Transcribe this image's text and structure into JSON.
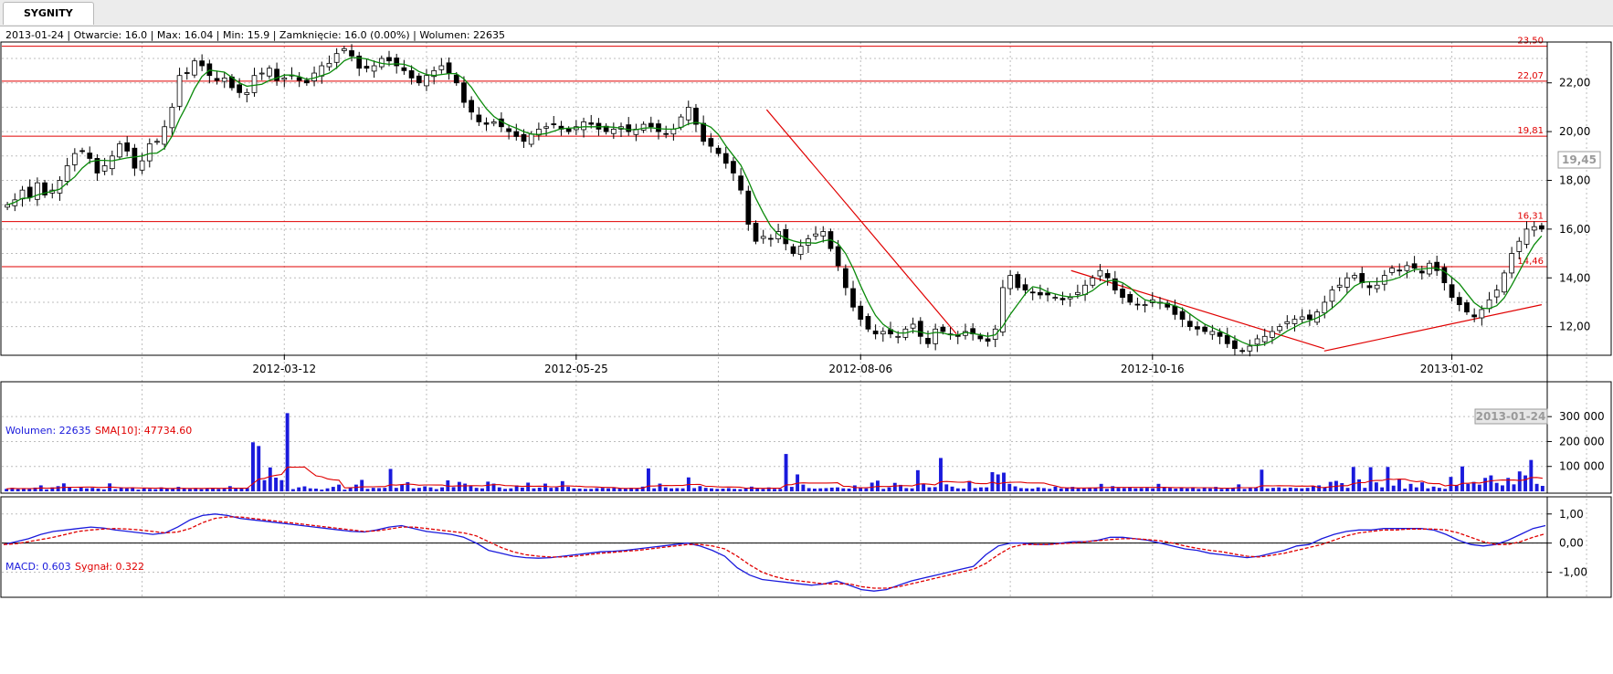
{
  "tab": {
    "label": "SYGNITY"
  },
  "info_line": "2013-01-24 | Otwarcie: 16.0 | Max: 16.04 | Min: 15.9 | Zamknięcie: 16.0 (0.00%)  | Wolumen: 22635",
  "cursor": {
    "price_label": "19,45",
    "date_label": "2013-01-24"
  },
  "volume_legend": {
    "volume": "Wolumen: 22635",
    "sma": "SMA[10]: 47734.60"
  },
  "macd_legend": {
    "macd": "MACD: 0.603",
    "signal": "Sygnał: 0.322"
  },
  "colors": {
    "up": "#ffffff",
    "down": "#000000",
    "sma": "#0a8a0a",
    "level": "#e00000",
    "volume": "#1a1adc",
    "vol_sma": "#e00000",
    "macd": "#1a1adc",
    "signal": "#e00000"
  },
  "chart_data": [
    {
      "type": "candlestick",
      "x_ticks": [
        "2012-03-12",
        "2012-05-25",
        "2012-08-06",
        "2012-10-16",
        "2013-01-02"
      ],
      "y_ticks": [
        "12,00",
        "14,00",
        "16,00",
        "18,00",
        "20,00",
        "22,00"
      ],
      "ylim": [
        10.9,
        23.6
      ],
      "horizontal_levels": [
        {
          "value": 23.5,
          "label": "23,50"
        },
        {
          "value": 22.07,
          "label": "22,07"
        },
        {
          "value": 19.81,
          "label": "19,81"
        },
        {
          "value": 16.31,
          "label": "16,31"
        },
        {
          "value": 14.46,
          "label": "14,46"
        }
      ],
      "closes": [
        17.0,
        17.2,
        17.6,
        17.3,
        17.9,
        17.4,
        17.6,
        18.0,
        18.6,
        19.1,
        19.2,
        18.9,
        18.3,
        18.6,
        19.0,
        19.5,
        19.2,
        18.5,
        18.8,
        19.5,
        19.6,
        20.2,
        21.0,
        22.3,
        22.4,
        22.9,
        22.7,
        22.3,
        22.1,
        22.2,
        21.8,
        21.6,
        21.6,
        22.3,
        22.4,
        22.6,
        22.1,
        22.2,
        22.3,
        22.1,
        22.0,
        22.4,
        22.7,
        22.8,
        23.2,
        23.4,
        23.1,
        22.6,
        22.6,
        22.7,
        23.0,
        22.9,
        22.7,
        22.5,
        22.2,
        22.0,
        22.3,
        22.5,
        22.7,
        22.4,
        22.0,
        21.2,
        20.8,
        20.4,
        20.3,
        20.4,
        20.2,
        20.0,
        19.8,
        19.6,
        19.9,
        20.1,
        20.2,
        20.3,
        20.1,
        20.0,
        20.2,
        20.4,
        20.3,
        20.1,
        20.0,
        20.1,
        20.2,
        20.0,
        20.1,
        20.3,
        20.2,
        20.0,
        19.9,
        20.1,
        20.6,
        21.0,
        20.3,
        19.6,
        19.4,
        19.1,
        18.7,
        18.3,
        17.6,
        16.2,
        15.5,
        15.7,
        15.6,
        15.9,
        15.4,
        15.0,
        15.3,
        15.6,
        15.8,
        15.9,
        15.2,
        14.5,
        13.6,
        12.8,
        12.3,
        11.9,
        11.7,
        11.8,
        11.7,
        11.6,
        11.9,
        12.1,
        11.6,
        11.3,
        11.9,
        11.8,
        11.7,
        11.6,
        11.8,
        11.7,
        11.5,
        11.4,
        11.9,
        13.6,
        14.1,
        13.6,
        13.5,
        13.4,
        13.3,
        13.3,
        13.2,
        13.1,
        13.2,
        13.4,
        13.7,
        14.0,
        14.3,
        14.0,
        13.5,
        13.2,
        13.0,
        12.9,
        12.9,
        13.1,
        13.0,
        12.8,
        12.5,
        12.3,
        12.0,
        11.9,
        11.8,
        11.8,
        11.6,
        11.3,
        11.1,
        11.0,
        11.2,
        11.5,
        11.6,
        11.8,
        12.0,
        12.2,
        12.3,
        12.4,
        12.3,
        12.6,
        13.0,
        13.5,
        13.7,
        14.0,
        14.1,
        13.8,
        13.6,
        13.7,
        14.1,
        14.4,
        14.3,
        14.5,
        14.4,
        14.2,
        14.6,
        14.3,
        13.8,
        13.2,
        12.9,
        12.6,
        12.4,
        12.7,
        13.1,
        13.5,
        14.2,
        15.0,
        15.5,
        16.0,
        16.1,
        16.0
      ],
      "sma_period": 5,
      "trendlines": [
        {
          "from": [
            "2012-07-12",
            20.9
          ],
          "to": [
            "2012-08-29",
            11.7
          ]
        },
        {
          "from": [
            "2012-09-27",
            14.3
          ],
          "to": [
            "2012-11-30",
            11.1
          ]
        },
        {
          "from": [
            "2012-11-30",
            11.0
          ],
          "to": [
            "2013-01-24",
            12.9
          ]
        }
      ]
    },
    {
      "type": "bar",
      "title": "Wolumen",
      "y_ticks": [
        "100 000",
        "200 000",
        "300 000"
      ],
      "ylim": [
        0,
        330000
      ],
      "values": [
        10000,
        14000,
        9000,
        12000,
        10000,
        15000,
        24000,
        8000,
        16000,
        21000,
        32000,
        17000,
        9000,
        18000,
        12000,
        14000,
        11000,
        8000,
        32000,
        9000,
        16000,
        12000,
        14000,
        7000,
        12000,
        10000,
        9000,
        16000,
        11000,
        11000,
        18000,
        12000,
        10000,
        13000,
        9000,
        12000,
        14000,
        10000,
        13000,
        21000,
        12000,
        11000,
        14000,
        197000,
        182000,
        45000,
        96000,
        55000,
        45000,
        314000,
        9000,
        16000,
        20000,
        12000,
        11000,
        7000,
        12000,
        18000,
        27000,
        7000,
        16000,
        27000,
        46000,
        10000,
        14000,
        13000,
        14000,
        90000,
        14000,
        28000,
        37000,
        12000,
        14000,
        20000,
        16000,
        9000,
        16000,
        44000,
        17000,
        38000,
        31000,
        24000,
        14000,
        12000,
        39000,
        31000,
        16000,
        10000,
        12000,
        24000,
        15000,
        35000,
        12000,
        15000,
        31000,
        14000,
        16000,
        41000,
        18000,
        12000,
        11000,
        10000,
        10000,
        13000,
        14000,
        12000,
        14000,
        11000,
        12000,
        14000,
        12000,
        19000,
        92000,
        12000,
        31000,
        16000,
        12000,
        13000,
        12000,
        56000,
        13000,
        21000,
        14000,
        12000,
        10000,
        11000,
        13000,
        10000,
        9000,
        14000,
        19000,
        13000,
        10000,
        16000,
        10000,
        10000,
        150000,
        18000,
        68000,
        27000,
        13000,
        11000,
        12000,
        13000,
        15000,
        16000,
        12000,
        11000,
        24000,
        16000,
        12000,
        35000,
        43000,
        10000,
        16000,
        34000,
        26000,
        13000,
        12000,
        85000,
        30000,
        16000,
        17000,
        134000,
        28000,
        19000,
        12000,
        11000,
        42000,
        13000,
        16000,
        16000,
        77000,
        68000,
        75000,
        30000,
        20000,
        13000,
        12000,
        11000,
        16000,
        13000,
        10000,
        19000,
        12000,
        14000,
        18000,
        12000,
        12000,
        14000,
        14000,
        30000,
        10000,
        21000,
        14000,
        13000,
        17000,
        12000,
        13000,
        14000,
        12000,
        30000,
        16000,
        14000,
        11000,
        13000,
        12000,
        16000,
        10000,
        13000,
        12000,
        18000,
        10000,
        14000,
        15000,
        28000,
        10000,
        16000,
        14000,
        87000,
        12000,
        14000,
        16000,
        12000,
        15000,
        13000,
        12000,
        14000,
        22000,
        24000,
        15000,
        38000,
        42000,
        33000,
        14000,
        98000,
        48000,
        14000,
        97000,
        36000,
        16000,
        98000,
        23000,
        48000,
        11000,
        30000,
        16000,
        36000,
        12000,
        19000,
        14000,
        10000,
        58000,
        26000,
        100000,
        30000,
        38000,
        27000,
        54000,
        64000,
        34000,
        24000,
        54000,
        28000,
        80000,
        64000,
        126000,
        30000,
        22000
      ],
      "sma_period": 10
    },
    {
      "type": "line",
      "title": "MACD",
      "y_ticks": [
        "-1,00",
        "0,00",
        "1,00"
      ],
      "ylim": [
        -1.8,
        1.15
      ],
      "series": [
        {
          "name": "MACD",
          "values": [
            -0.05,
            0.05,
            0.15,
            0.3,
            0.4,
            0.45,
            0.5,
            0.55,
            0.52,
            0.45,
            0.4,
            0.35,
            0.3,
            0.35,
            0.55,
            0.8,
            0.95,
            1.0,
            0.95,
            0.85,
            0.8,
            0.75,
            0.7,
            0.65,
            0.6,
            0.55,
            0.5,
            0.45,
            0.4,
            0.38,
            0.45,
            0.55,
            0.6,
            0.5,
            0.4,
            0.35,
            0.3,
            0.2,
            0.0,
            -0.25,
            -0.35,
            -0.45,
            -0.5,
            -0.52,
            -0.5,
            -0.45,
            -0.4,
            -0.35,
            -0.3,
            -0.28,
            -0.25,
            -0.2,
            -0.15,
            -0.1,
            -0.05,
            0.0,
            -0.1,
            -0.25,
            -0.45,
            -0.85,
            -1.1,
            -1.25,
            -1.3,
            -1.35,
            -1.4,
            -1.45,
            -1.4,
            -1.3,
            -1.45,
            -1.6,
            -1.65,
            -1.6,
            -1.45,
            -1.3,
            -1.2,
            -1.1,
            -1.0,
            -0.9,
            -0.8,
            -0.4,
            -0.1,
            0.0,
            0.0,
            -0.05,
            -0.05,
            0.0,
            0.05,
            0.05,
            0.1,
            0.2,
            0.2,
            0.15,
            0.1,
            0.0,
            -0.1,
            -0.2,
            -0.25,
            -0.35,
            -0.4,
            -0.45,
            -0.5,
            -0.45,
            -0.35,
            -0.25,
            -0.1,
            -0.05,
            0.15,
            0.3,
            0.4,
            0.45,
            0.45,
            0.5,
            0.5,
            0.5,
            0.5,
            0.45,
            0.3,
            0.1,
            -0.05,
            -0.1,
            -0.05,
            0.1,
            0.3,
            0.5,
            0.6
          ]
        },
        {
          "name": "Sygnał",
          "values": [
            -0.05,
            -0.02,
            0.05,
            0.12,
            0.2,
            0.3,
            0.4,
            0.45,
            0.48,
            0.5,
            0.48,
            0.45,
            0.4,
            0.35,
            0.38,
            0.5,
            0.7,
            0.85,
            0.9,
            0.9,
            0.85,
            0.8,
            0.75,
            0.7,
            0.65,
            0.6,
            0.55,
            0.5,
            0.45,
            0.4,
            0.42,
            0.48,
            0.55,
            0.55,
            0.5,
            0.45,
            0.4,
            0.35,
            0.25,
            0.05,
            -0.15,
            -0.3,
            -0.4,
            -0.45,
            -0.48,
            -0.48,
            -0.45,
            -0.4,
            -0.35,
            -0.32,
            -0.28,
            -0.25,
            -0.2,
            -0.15,
            -0.1,
            -0.05,
            -0.05,
            -0.1,
            -0.2,
            -0.45,
            -0.75,
            -1.0,
            -1.15,
            -1.25,
            -1.3,
            -1.35,
            -1.4,
            -1.4,
            -1.4,
            -1.5,
            -1.55,
            -1.55,
            -1.5,
            -1.4,
            -1.3,
            -1.2,
            -1.1,
            -1.0,
            -0.9,
            -0.7,
            -0.4,
            -0.15,
            -0.05,
            -0.05,
            -0.05,
            -0.02,
            0.0,
            0.05,
            0.08,
            0.12,
            0.15,
            0.15,
            0.12,
            0.08,
            0.0,
            -0.1,
            -0.18,
            -0.25,
            -0.3,
            -0.38,
            -0.45,
            -0.48,
            -0.42,
            -0.35,
            -0.25,
            -0.15,
            -0.05,
            0.1,
            0.25,
            0.35,
            0.4,
            0.45,
            0.45,
            0.48,
            0.48,
            0.48,
            0.45,
            0.35,
            0.2,
            0.05,
            -0.05,
            -0.05,
            0.05,
            0.2,
            0.32
          ]
        }
      ]
    }
  ]
}
